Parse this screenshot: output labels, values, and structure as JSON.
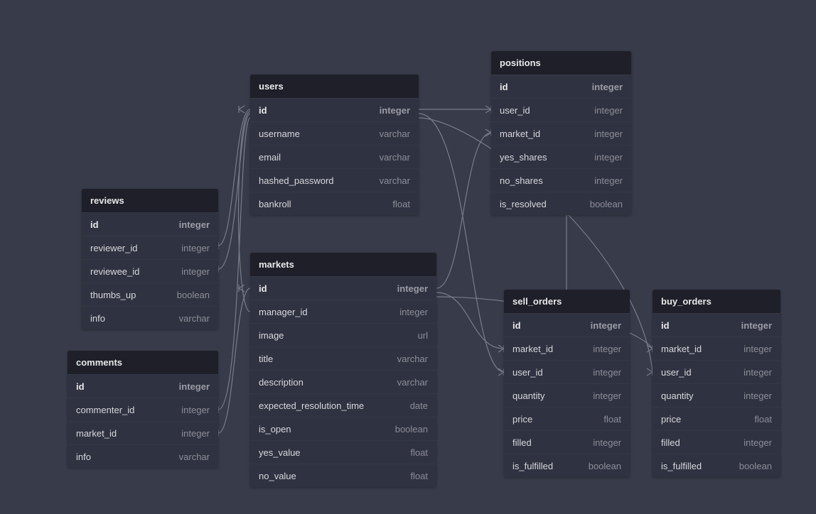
{
  "tables": {
    "reviews": {
      "name": "reviews",
      "cols": [
        {
          "name": "id",
          "type": "integer",
          "pk": true
        },
        {
          "name": "reviewer_id",
          "type": "integer"
        },
        {
          "name": "reviewee_id",
          "type": "integer"
        },
        {
          "name": "thumbs_up",
          "type": "boolean"
        },
        {
          "name": "info",
          "type": "varchar"
        }
      ]
    },
    "comments": {
      "name": "comments",
      "cols": [
        {
          "name": "id",
          "type": "integer",
          "pk": true
        },
        {
          "name": "commenter_id",
          "type": "integer"
        },
        {
          "name": "market_id",
          "type": "integer"
        },
        {
          "name": "info",
          "type": "varchar"
        }
      ]
    },
    "users": {
      "name": "users",
      "cols": [
        {
          "name": "id",
          "type": "integer",
          "pk": true
        },
        {
          "name": "username",
          "type": "varchar"
        },
        {
          "name": "email",
          "type": "varchar"
        },
        {
          "name": "hashed_password",
          "type": "varchar"
        },
        {
          "name": "bankroll",
          "type": "float"
        }
      ]
    },
    "markets": {
      "name": "markets",
      "cols": [
        {
          "name": "id",
          "type": "integer",
          "pk": true
        },
        {
          "name": "manager_id",
          "type": "integer"
        },
        {
          "name": "image",
          "type": "url"
        },
        {
          "name": "title",
          "type": "varchar"
        },
        {
          "name": "description",
          "type": "varchar"
        },
        {
          "name": "expected_resolution_time",
          "type": "date"
        },
        {
          "name": "is_open",
          "type": "boolean"
        },
        {
          "name": "yes_value",
          "type": "float"
        },
        {
          "name": "no_value",
          "type": "float"
        }
      ]
    },
    "positions": {
      "name": "positions",
      "cols": [
        {
          "name": "id",
          "type": "integer",
          "pk": true
        },
        {
          "name": "user_id",
          "type": "integer"
        },
        {
          "name": "market_id",
          "type": "integer"
        },
        {
          "name": "yes_shares",
          "type": "integer"
        },
        {
          "name": "no_shares",
          "type": "integer"
        },
        {
          "name": "is_resolved",
          "type": "boolean"
        }
      ]
    },
    "sell_orders": {
      "name": "sell_orders",
      "cols": [
        {
          "name": "id",
          "type": "integer",
          "pk": true
        },
        {
          "name": "market_id",
          "type": "integer"
        },
        {
          "name": "user_id",
          "type": "integer"
        },
        {
          "name": "quantity",
          "type": "integer"
        },
        {
          "name": "price",
          "type": "float"
        },
        {
          "name": "filled",
          "type": "integer"
        },
        {
          "name": "is_fulfilled",
          "type": "boolean"
        }
      ]
    },
    "buy_orders": {
      "name": "buy_orders",
      "cols": [
        {
          "name": "id",
          "type": "integer",
          "pk": true
        },
        {
          "name": "market_id",
          "type": "integer"
        },
        {
          "name": "user_id",
          "type": "integer"
        },
        {
          "name": "quantity",
          "type": "integer"
        },
        {
          "name": "price",
          "type": "float"
        },
        {
          "name": "filled",
          "type": "integer"
        },
        {
          "name": "is_fulfilled",
          "type": "boolean"
        }
      ]
    }
  },
  "connectors": [
    {
      "from": "reviews.reviewer_id",
      "to": "users.id"
    },
    {
      "from": "reviews.reviewee_id",
      "to": "users.id"
    },
    {
      "from": "comments.commenter_id",
      "to": "users.id"
    },
    {
      "from": "comments.market_id",
      "to": "markets.id"
    },
    {
      "from": "markets.manager_id",
      "to": "users.id"
    },
    {
      "from": "positions.user_id",
      "to": "users.id"
    },
    {
      "from": "positions.market_id",
      "to": "markets.id"
    },
    {
      "from": "sell_orders.market_id",
      "to": "markets.id"
    },
    {
      "from": "sell_orders.user_id",
      "to": "users.id"
    },
    {
      "from": "buy_orders.market_id",
      "to": "markets.id"
    },
    {
      "from": "buy_orders.user_id",
      "to": "users.id"
    },
    {
      "from": "positions.is_resolved_area",
      "to": "sell_orders.id_area",
      "note": "vertical link visual"
    }
  ]
}
